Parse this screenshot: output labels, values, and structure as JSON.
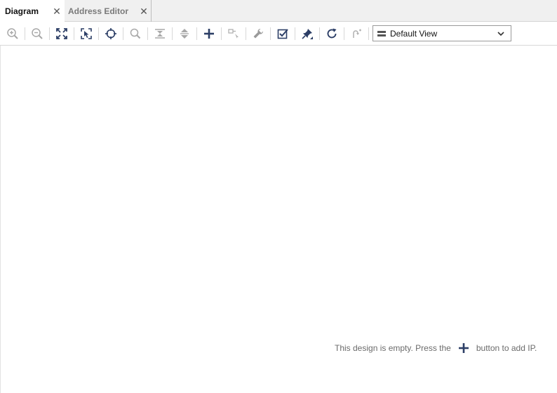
{
  "tabs": [
    {
      "label": "Diagram",
      "active": true
    },
    {
      "label": "Address Editor",
      "active": false
    }
  ],
  "toolbar": {
    "icons": [
      "zoom-in-icon",
      "zoom-out-icon",
      "fit-icon",
      "zoom-select-icon",
      "center-icon",
      "search-icon",
      "collapse-icon",
      "expand-icon",
      "add-ip-icon",
      "connect-icon",
      "wrench-icon",
      "validate-icon",
      "pin-icon",
      "refresh-icon",
      "regenerate-icon"
    ],
    "view_select": {
      "value": "Default View"
    }
  },
  "canvas": {
    "empty_prefix": "This design is empty. Press the",
    "empty_suffix": "button to add IP."
  },
  "colors": {
    "accent": "#2c3e66",
    "disabled": "#9aa0a6",
    "tab_bg": "#f0f0f0"
  }
}
